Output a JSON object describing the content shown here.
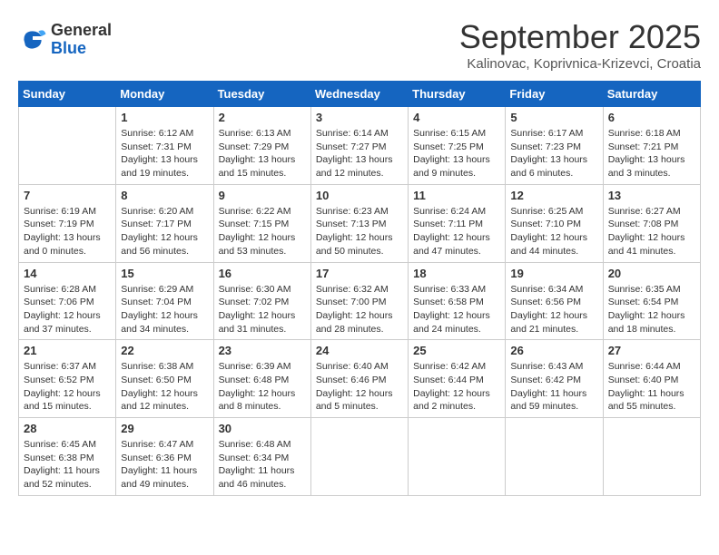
{
  "logo": {
    "general": "General",
    "blue": "Blue"
  },
  "header": {
    "month": "September 2025",
    "location": "Kalinovac, Koprivnica-Krizevci, Croatia"
  },
  "days_of_week": [
    "Sunday",
    "Monday",
    "Tuesday",
    "Wednesday",
    "Thursday",
    "Friday",
    "Saturday"
  ],
  "weeks": [
    [
      {
        "day": "",
        "info": ""
      },
      {
        "day": "1",
        "info": "Sunrise: 6:12 AM\nSunset: 7:31 PM\nDaylight: 13 hours\nand 19 minutes."
      },
      {
        "day": "2",
        "info": "Sunrise: 6:13 AM\nSunset: 7:29 PM\nDaylight: 13 hours\nand 15 minutes."
      },
      {
        "day": "3",
        "info": "Sunrise: 6:14 AM\nSunset: 7:27 PM\nDaylight: 13 hours\nand 12 minutes."
      },
      {
        "day": "4",
        "info": "Sunrise: 6:15 AM\nSunset: 7:25 PM\nDaylight: 13 hours\nand 9 minutes."
      },
      {
        "day": "5",
        "info": "Sunrise: 6:17 AM\nSunset: 7:23 PM\nDaylight: 13 hours\nand 6 minutes."
      },
      {
        "day": "6",
        "info": "Sunrise: 6:18 AM\nSunset: 7:21 PM\nDaylight: 13 hours\nand 3 minutes."
      }
    ],
    [
      {
        "day": "7",
        "info": "Sunrise: 6:19 AM\nSunset: 7:19 PM\nDaylight: 13 hours\nand 0 minutes."
      },
      {
        "day": "8",
        "info": "Sunrise: 6:20 AM\nSunset: 7:17 PM\nDaylight: 12 hours\nand 56 minutes."
      },
      {
        "day": "9",
        "info": "Sunrise: 6:22 AM\nSunset: 7:15 PM\nDaylight: 12 hours\nand 53 minutes."
      },
      {
        "day": "10",
        "info": "Sunrise: 6:23 AM\nSunset: 7:13 PM\nDaylight: 12 hours\nand 50 minutes."
      },
      {
        "day": "11",
        "info": "Sunrise: 6:24 AM\nSunset: 7:11 PM\nDaylight: 12 hours\nand 47 minutes."
      },
      {
        "day": "12",
        "info": "Sunrise: 6:25 AM\nSunset: 7:10 PM\nDaylight: 12 hours\nand 44 minutes."
      },
      {
        "day": "13",
        "info": "Sunrise: 6:27 AM\nSunset: 7:08 PM\nDaylight: 12 hours\nand 41 minutes."
      }
    ],
    [
      {
        "day": "14",
        "info": "Sunrise: 6:28 AM\nSunset: 7:06 PM\nDaylight: 12 hours\nand 37 minutes."
      },
      {
        "day": "15",
        "info": "Sunrise: 6:29 AM\nSunset: 7:04 PM\nDaylight: 12 hours\nand 34 minutes."
      },
      {
        "day": "16",
        "info": "Sunrise: 6:30 AM\nSunset: 7:02 PM\nDaylight: 12 hours\nand 31 minutes."
      },
      {
        "day": "17",
        "info": "Sunrise: 6:32 AM\nSunset: 7:00 PM\nDaylight: 12 hours\nand 28 minutes."
      },
      {
        "day": "18",
        "info": "Sunrise: 6:33 AM\nSunset: 6:58 PM\nDaylight: 12 hours\nand 24 minutes."
      },
      {
        "day": "19",
        "info": "Sunrise: 6:34 AM\nSunset: 6:56 PM\nDaylight: 12 hours\nand 21 minutes."
      },
      {
        "day": "20",
        "info": "Sunrise: 6:35 AM\nSunset: 6:54 PM\nDaylight: 12 hours\nand 18 minutes."
      }
    ],
    [
      {
        "day": "21",
        "info": "Sunrise: 6:37 AM\nSunset: 6:52 PM\nDaylight: 12 hours\nand 15 minutes."
      },
      {
        "day": "22",
        "info": "Sunrise: 6:38 AM\nSunset: 6:50 PM\nDaylight: 12 hours\nand 12 minutes."
      },
      {
        "day": "23",
        "info": "Sunrise: 6:39 AM\nSunset: 6:48 PM\nDaylight: 12 hours\nand 8 minutes."
      },
      {
        "day": "24",
        "info": "Sunrise: 6:40 AM\nSunset: 6:46 PM\nDaylight: 12 hours\nand 5 minutes."
      },
      {
        "day": "25",
        "info": "Sunrise: 6:42 AM\nSunset: 6:44 PM\nDaylight: 12 hours\nand 2 minutes."
      },
      {
        "day": "26",
        "info": "Sunrise: 6:43 AM\nSunset: 6:42 PM\nDaylight: 11 hours\nand 59 minutes."
      },
      {
        "day": "27",
        "info": "Sunrise: 6:44 AM\nSunset: 6:40 PM\nDaylight: 11 hours\nand 55 minutes."
      }
    ],
    [
      {
        "day": "28",
        "info": "Sunrise: 6:45 AM\nSunset: 6:38 PM\nDaylight: 11 hours\nand 52 minutes."
      },
      {
        "day": "29",
        "info": "Sunrise: 6:47 AM\nSunset: 6:36 PM\nDaylight: 11 hours\nand 49 minutes."
      },
      {
        "day": "30",
        "info": "Sunrise: 6:48 AM\nSunset: 6:34 PM\nDaylight: 11 hours\nand 46 minutes."
      },
      {
        "day": "",
        "info": ""
      },
      {
        "day": "",
        "info": ""
      },
      {
        "day": "",
        "info": ""
      },
      {
        "day": "",
        "info": ""
      }
    ]
  ]
}
